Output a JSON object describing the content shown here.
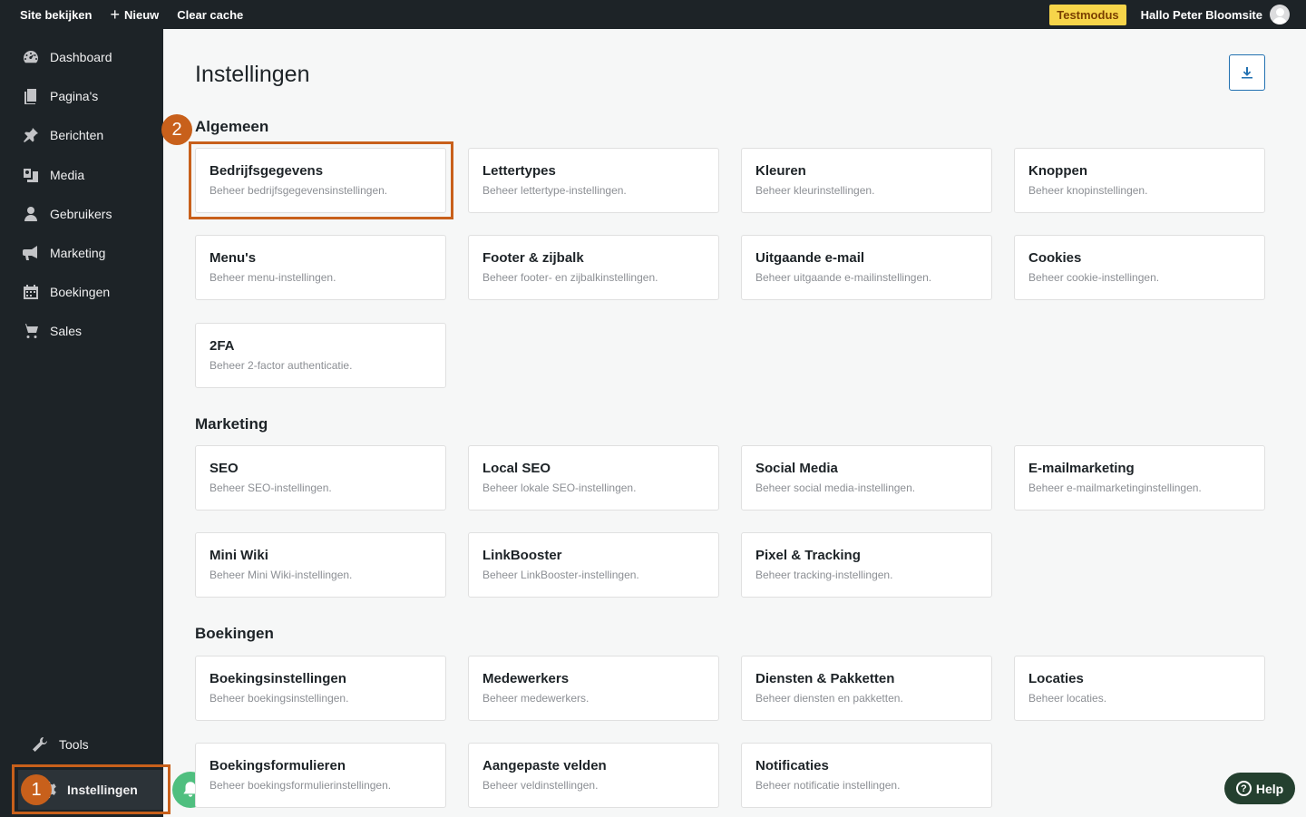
{
  "topbar": {
    "view_site": "Site bekijken",
    "new": "Nieuw",
    "clear_cache": "Clear cache",
    "testmode": "Testmodus",
    "greeting": "Hallo Peter Bloomsite"
  },
  "sidebar": {
    "items": [
      {
        "label": "Dashboard",
        "icon": "dashboard-icon"
      },
      {
        "label": "Pagina's",
        "icon": "pages-icon"
      },
      {
        "label": "Berichten",
        "icon": "pin-icon"
      },
      {
        "label": "Media",
        "icon": "media-icon"
      },
      {
        "label": "Gebruikers",
        "icon": "user-icon"
      },
      {
        "label": "Marketing",
        "icon": "megaphone-icon"
      },
      {
        "label": "Boekingen",
        "icon": "calendar-icon"
      },
      {
        "label": "Sales",
        "icon": "cart-icon"
      }
    ],
    "tools": "Tools",
    "settings": "Instellingen"
  },
  "annotations": {
    "step1": "1",
    "step2": "2"
  },
  "main": {
    "title": "Instellingen",
    "sections": [
      {
        "title": "Algemeen",
        "cards": [
          {
            "title": "Bedrijfsgegevens",
            "desc": "Beheer bedrijfsgegevensinstellingen."
          },
          {
            "title": "Lettertypes",
            "desc": "Beheer lettertype-instellingen."
          },
          {
            "title": "Kleuren",
            "desc": "Beheer kleurinstellingen."
          },
          {
            "title": "Knoppen",
            "desc": "Beheer knopinstellingen."
          },
          {
            "title": "Menu's",
            "desc": "Beheer menu-instellingen."
          },
          {
            "title": "Footer & zijbalk",
            "desc": "Beheer footer- en zijbalkinstellingen."
          },
          {
            "title": "Uitgaande e-mail",
            "desc": "Beheer uitgaande e-mailinstellingen."
          },
          {
            "title": "Cookies",
            "desc": "Beheer cookie-instellingen."
          },
          {
            "title": "2FA",
            "desc": "Beheer 2-factor authenticatie."
          }
        ]
      },
      {
        "title": "Marketing",
        "cards": [
          {
            "title": "SEO",
            "desc": "Beheer SEO-instellingen."
          },
          {
            "title": "Local SEO",
            "desc": "Beheer lokale SEO-instellingen."
          },
          {
            "title": "Social Media",
            "desc": "Beheer social media-instellingen."
          },
          {
            "title": "E-mailmarketing",
            "desc": "Beheer e-mailmarketinginstellingen."
          },
          {
            "title": "Mini Wiki",
            "desc": "Beheer Mini Wiki-instellingen."
          },
          {
            "title": "LinkBooster",
            "desc": "Beheer LinkBooster-instellingen."
          },
          {
            "title": "Pixel & Tracking",
            "desc": "Beheer tracking-instellingen."
          }
        ]
      },
      {
        "title": "Boekingen",
        "cards": [
          {
            "title": "Boekingsinstellingen",
            "desc": "Beheer boekingsinstellingen."
          },
          {
            "title": "Medewerkers",
            "desc": "Beheer medewerkers."
          },
          {
            "title": "Diensten & Pakketten",
            "desc": "Beheer diensten en pakketten."
          },
          {
            "title": "Locaties",
            "desc": "Beheer locaties."
          },
          {
            "title": "Boekingsformulieren",
            "desc": "Beheer boekingsformulierinstellingen."
          },
          {
            "title": "Aangepaste velden",
            "desc": "Beheer veldinstellingen."
          },
          {
            "title": "Notificaties",
            "desc": "Beheer notificatie instellingen."
          }
        ]
      }
    ]
  },
  "help": {
    "label": "Help"
  }
}
